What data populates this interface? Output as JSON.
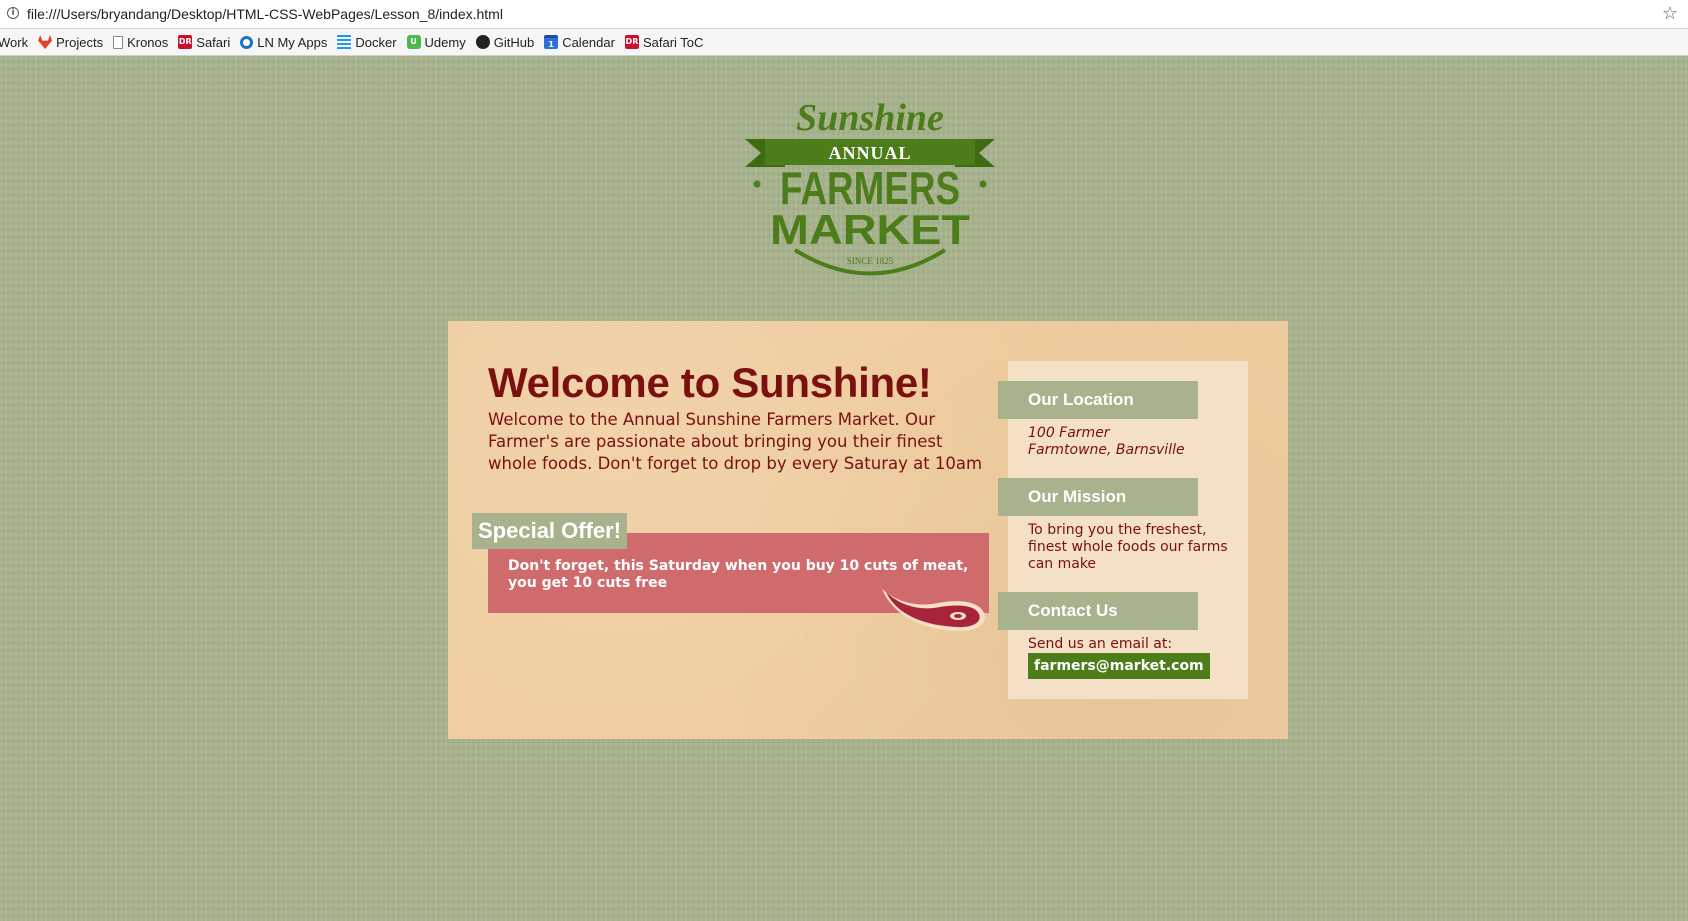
{
  "browser": {
    "url": "file:///Users/bryandang/Desktop/HTML-CSS-WebPages/Lesson_8/index.html",
    "bookmarks": [
      {
        "label": "Work",
        "icon": "none"
      },
      {
        "label": "Projects",
        "icon": "gitlab-icon"
      },
      {
        "label": "Kronos",
        "icon": "file-icon"
      },
      {
        "label": "Safari",
        "icon": "dr-icon"
      },
      {
        "label": "LN My Apps",
        "icon": "ln-icon"
      },
      {
        "label": "Docker",
        "icon": "docker-icon"
      },
      {
        "label": "Udemy",
        "icon": "udemy-icon"
      },
      {
        "label": "GitHub",
        "icon": "github-icon"
      },
      {
        "label": "Calendar",
        "icon": "calendar-icon"
      },
      {
        "label": "Safari ToC",
        "icon": "dr-icon"
      }
    ]
  },
  "logo": {
    "top": "Sunshine",
    "banner": "ANNUAL",
    "line1": "FARMERS",
    "line2": "MARKET",
    "since": "SINCE 1825"
  },
  "main": {
    "title": "Welcome to Sunshine!",
    "intro": "Welcome to the Annual Sunshine Farmers Market. Our Farmer's are passionate about bringing you their finest whole foods. Don't forget to drop by every Saturay at 10am",
    "offer_badge": "Special Offer!",
    "offer_text": "Don't forget, this Saturday when you buy 10 cuts of meat, you get 10 cuts free"
  },
  "sidebar": {
    "location_title": "Our Location",
    "address_line1": "100 Farmer",
    "address_line2": "Farmtowne, Barnsville",
    "mission_title": "Our Mission",
    "mission_text": "To bring you the freshest, finest whole foods our farms can make",
    "contact_title": "Contact Us",
    "contact_text": "Send us an email at:",
    "email": "farmers@market.com"
  },
  "colors": {
    "page_background": "#a8b38e",
    "card_background": "#efcc9e",
    "sidebar_background": "#f4dfc7",
    "title_color": "#7a1010",
    "offer_background": "#cf6b6c",
    "logo_green": "#4d7d1a"
  }
}
